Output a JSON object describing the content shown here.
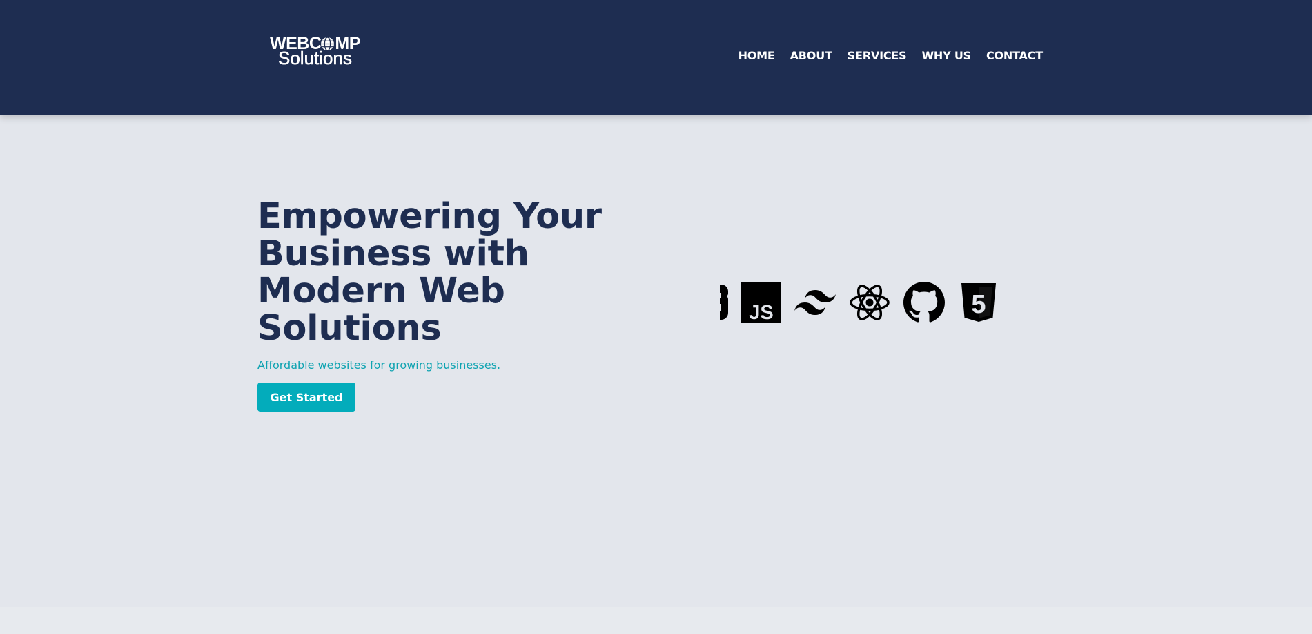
{
  "brand": {
    "line1": "WEBC",
    "line1_end": "MP",
    "line2": "Solutions"
  },
  "nav": [
    {
      "label": "HOME"
    },
    {
      "label": "ABOUT"
    },
    {
      "label": "SERVICES"
    },
    {
      "label": "WHY US"
    },
    {
      "label": "CONTACT"
    }
  ],
  "hero": {
    "title_lines": [
      "Empowering Your",
      "Business with",
      "Modern Web",
      "Solutions"
    ],
    "subtitle": "Affordable websites for growing businesses.",
    "cta_label": "Get Started"
  },
  "tech_logos": {
    "items": [
      "partial-logo-icon",
      "javascript-icon",
      "tailwind-icon",
      "react-icon",
      "github-icon",
      "html5-icon"
    ],
    "js_text": "JS",
    "html5_text": "5"
  },
  "colors": {
    "navbar": "#1e2d51",
    "hero_bg": "#e3e6ec",
    "title": "#1e2d51",
    "accent": "#03acbb",
    "subtitle": "#0fa3b1"
  }
}
